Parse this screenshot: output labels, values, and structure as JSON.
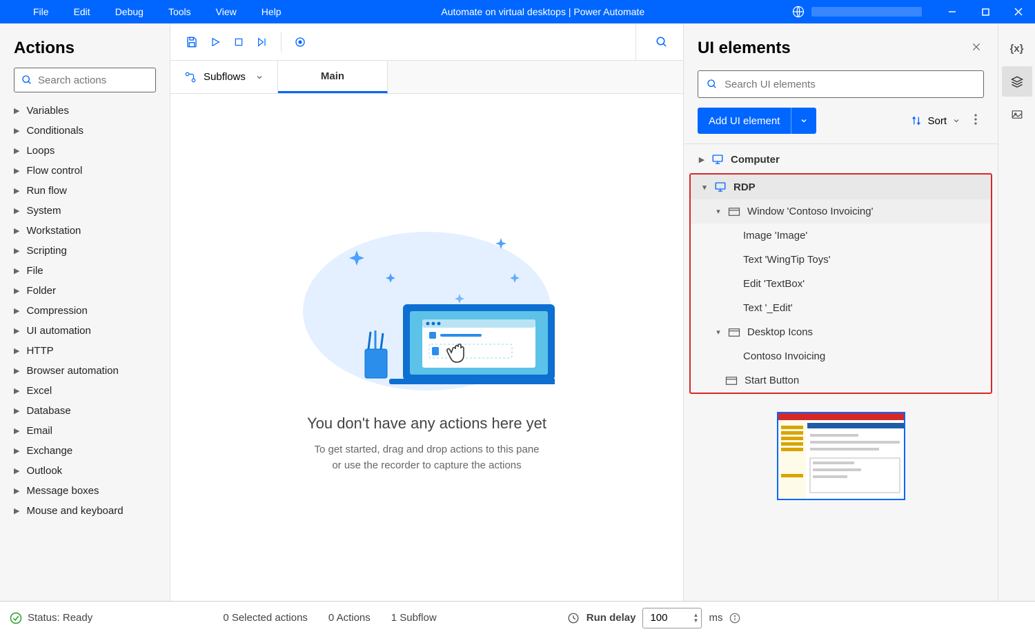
{
  "titlebar": {
    "menus": [
      "File",
      "Edit",
      "Debug",
      "Tools",
      "View",
      "Help"
    ],
    "title": "Automate on virtual desktops | Power Automate"
  },
  "actions": {
    "title": "Actions",
    "search_placeholder": "Search actions",
    "items": [
      "Variables",
      "Conditionals",
      "Loops",
      "Flow control",
      "Run flow",
      "System",
      "Workstation",
      "Scripting",
      "File",
      "Folder",
      "Compression",
      "UI automation",
      "HTTP",
      "Browser automation",
      "Excel",
      "Database",
      "Email",
      "Exchange",
      "Outlook",
      "Message boxes",
      "Mouse and keyboard"
    ]
  },
  "subflows": {
    "label": "Subflows",
    "main_tab": "Main"
  },
  "canvas": {
    "title": "You don't have any actions here yet",
    "sub1": "To get started, drag and drop actions to this pane",
    "sub2": "or use the recorder to capture the actions"
  },
  "ui_panel": {
    "title": "UI elements",
    "search_placeholder": "Search UI elements",
    "add_label": "Add UI element",
    "sort_label": "Sort",
    "tree": {
      "computer": "Computer",
      "rdp": "RDP",
      "window": "Window 'Contoso Invoicing'",
      "items": [
        "Image 'Image'",
        "Text 'WingTip Toys'",
        "Edit 'TextBox'",
        "Text '_Edit'"
      ],
      "desktop_icons": "Desktop Icons",
      "desktop_item": "Contoso Invoicing",
      "start_button": "Start Button"
    }
  },
  "status": {
    "ready": "Status: Ready",
    "selected": "0 Selected actions",
    "actions": "0 Actions",
    "subflow": "1 Subflow",
    "run_delay_label": "Run delay",
    "delay_value": "100",
    "ms": "ms"
  }
}
